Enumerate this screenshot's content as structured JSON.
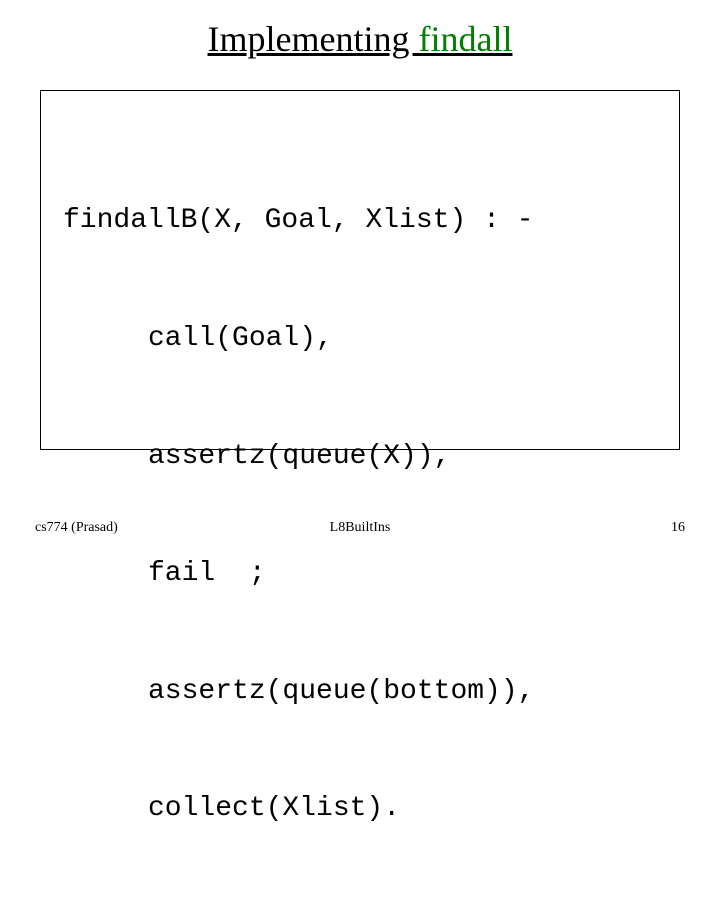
{
  "title": {
    "part1": "Implementing ",
    "part2": "findall"
  },
  "code": {
    "line1": "findallB(X, Goal, Xlist) : -",
    "line2": "call(Goal),",
    "line3": "assertz(queue(X)),",
    "line4": "fail  ;",
    "line5": "assertz(queue(bottom)),",
    "line6": "collect(Xlist)."
  },
  "footer": {
    "left": "cs774 (Prasad)",
    "center": "L8BuiltIns",
    "right": "16"
  }
}
